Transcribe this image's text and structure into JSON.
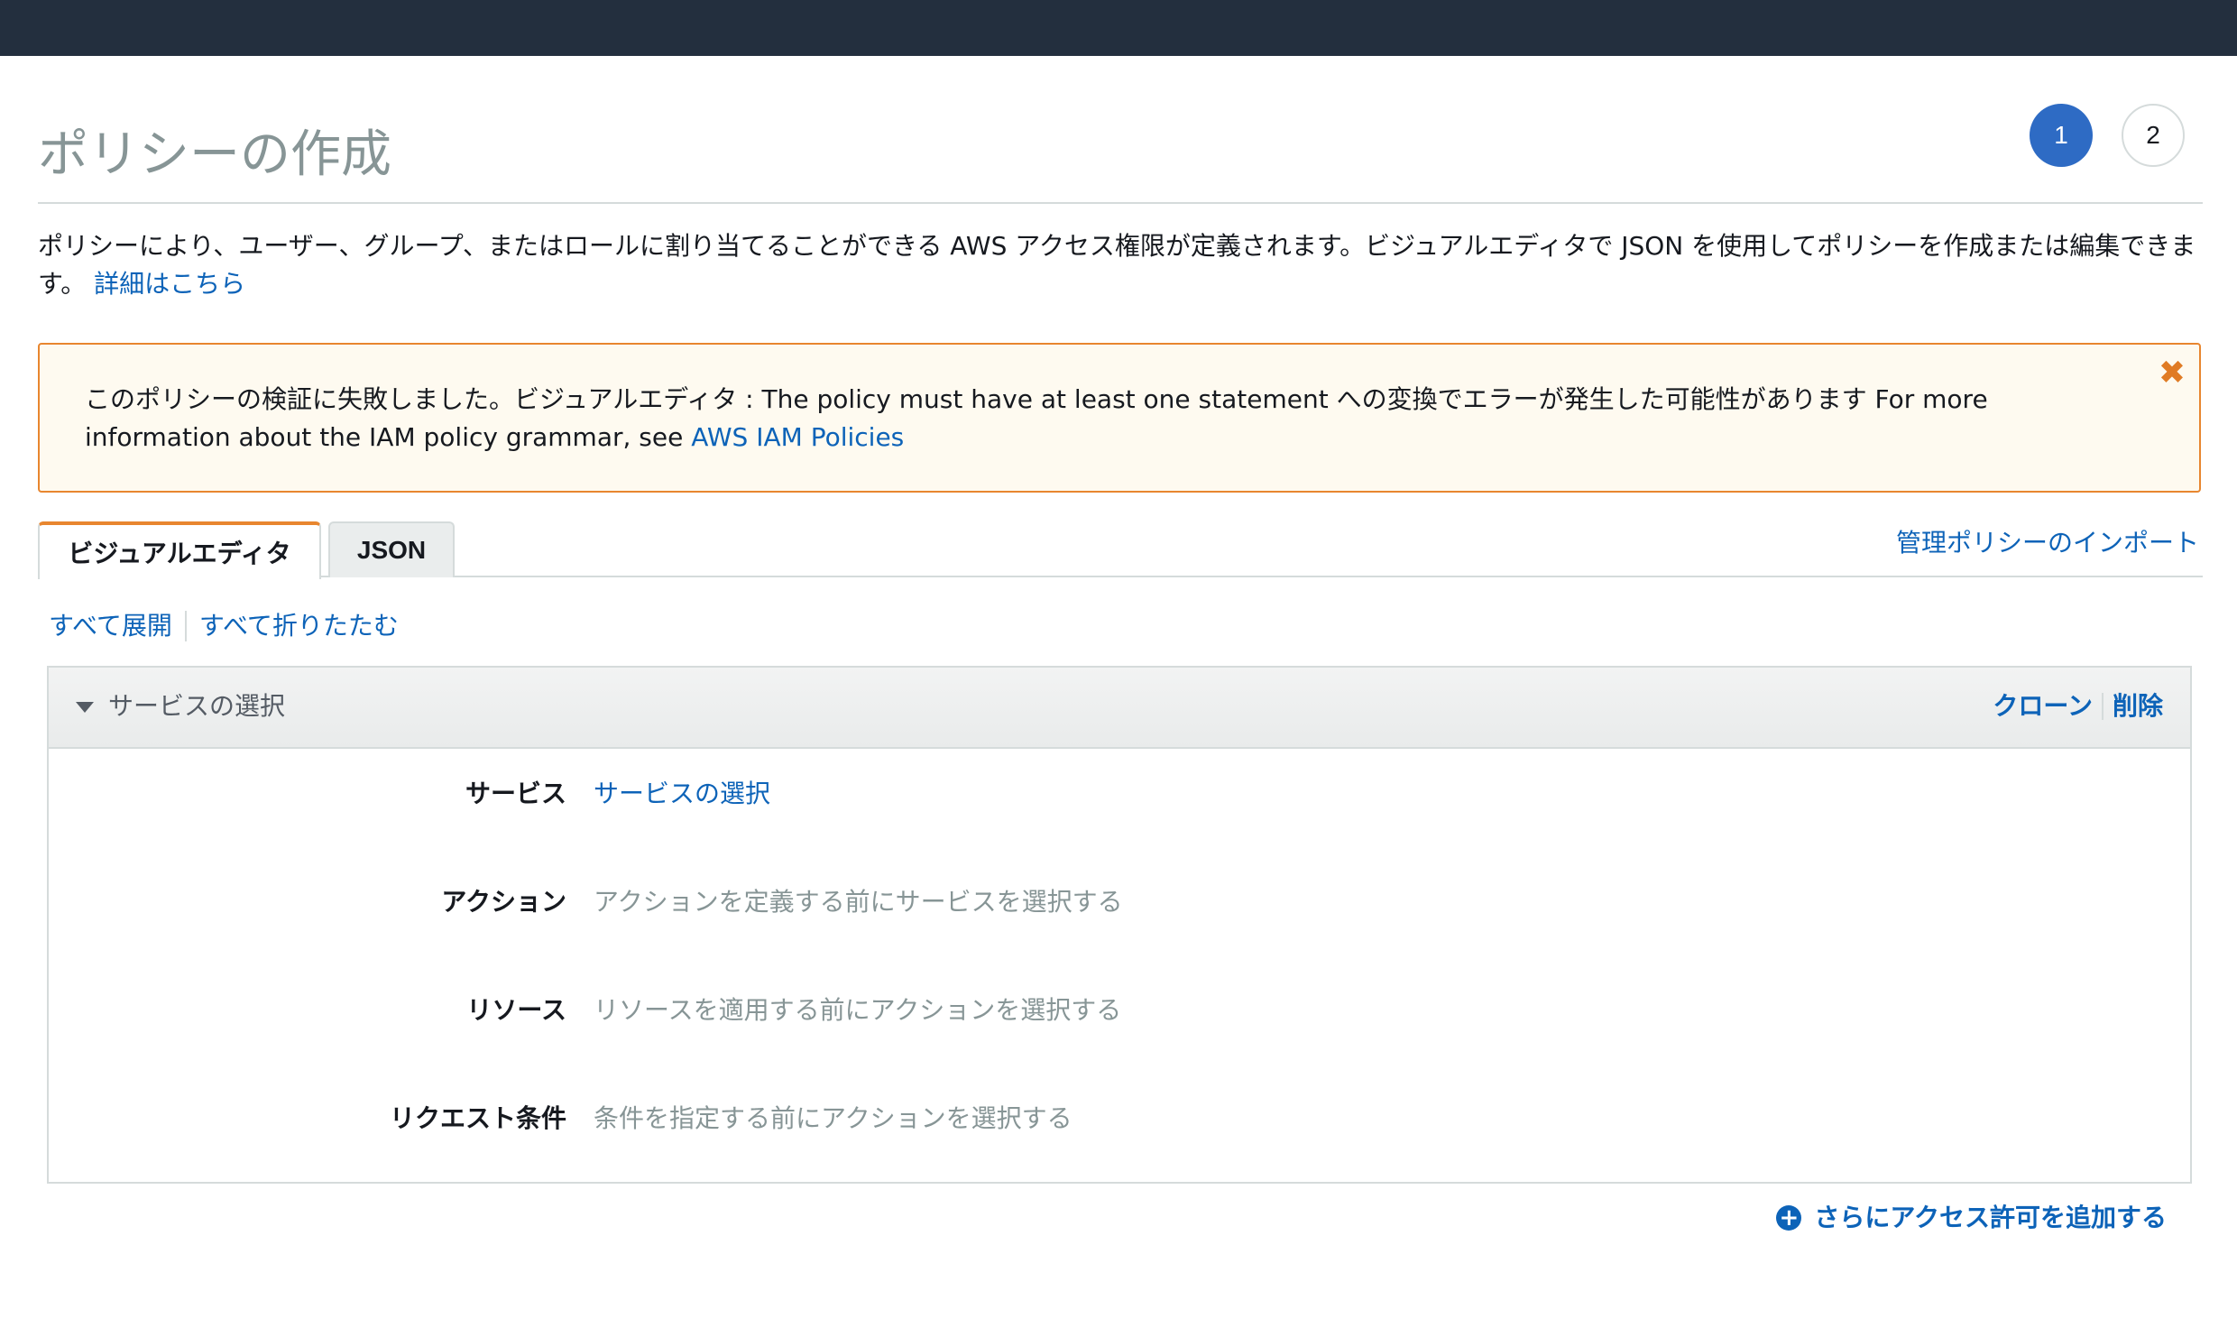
{
  "page": {
    "title": "ポリシーの作成",
    "steps": [
      "1",
      "2"
    ],
    "intro_text": "ポリシーにより、ユーザー、グループ、またはロールに割り当てることができる AWS アクセス権限が定義されます。ビジュアルエディタで JSON を使用してポリシーを作成または編集できます。",
    "intro_link": "詳細はこちら"
  },
  "alert": {
    "text": "このポリシーの検証に失敗しました。ビジュアルエディタ : The policy must have at least one statement への変換でエラーが発生した可能性があります For more information about the IAM policy grammar, see ",
    "link": "AWS IAM Policies",
    "close_glyph": "✖"
  },
  "tabs": {
    "visual": "ビジュアルエディタ",
    "json": "JSON",
    "import": "管理ポリシーのインポート"
  },
  "expand": {
    "expand_all": "すべて展開",
    "collapse_all": "すべて折りたたむ"
  },
  "panel": {
    "title": "サービスの選択",
    "clone": "クローン",
    "delete": "削除",
    "rows": [
      {
        "label": "サービス",
        "value": "サービスの選択"
      },
      {
        "label": "アクション",
        "value": "アクションを定義する前にサービスを選択する"
      },
      {
        "label": "リソース",
        "value": "リソースを適用する前にアクションを選択する"
      },
      {
        "label": "リクエスト条件",
        "value": "条件を指定する前にアクションを選択する"
      }
    ]
  },
  "add_permission": "さらにアクセス許可を追加する",
  "colors": {
    "topbar": "#232f3e",
    "accent_blue": "#2e6bc4",
    "link": "#0d63b8",
    "warning": "#e8862f"
  }
}
